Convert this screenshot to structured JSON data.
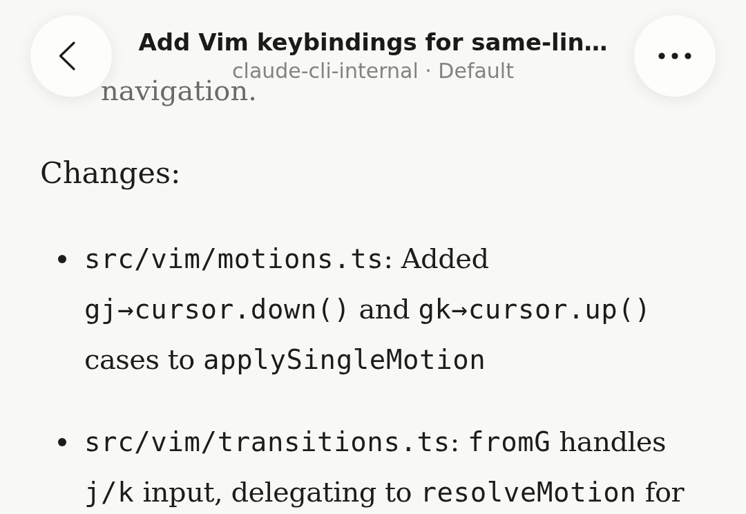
{
  "header": {
    "title": "Add Vim keybindings for same-lin…",
    "subtitle": "claude-cli-internal · Default"
  },
  "body": {
    "previous_text": "navigation.",
    "heading": "Changes:",
    "list": [
      {
        "segments": [
          {
            "kind": "code",
            "text": "src/vim/motions.ts"
          },
          {
            "kind": "text",
            "text": ": Added "
          },
          {
            "kind": "code",
            "text": "gj→cursor.down()"
          },
          {
            "kind": "text",
            "text": " and "
          },
          {
            "kind": "code",
            "text": "gk→cursor.up()"
          },
          {
            "kind": "text",
            "text": " cases to "
          },
          {
            "kind": "code",
            "text": "applySingleMotion"
          }
        ]
      },
      {
        "segments": [
          {
            "kind": "code",
            "text": "src/vim/transitions.ts"
          },
          {
            "kind": "text",
            "text": ": "
          },
          {
            "kind": "code",
            "text": "fromG"
          },
          {
            "kind": "text",
            "text": " handles "
          },
          {
            "kind": "code",
            "text": "j/k"
          },
          {
            "kind": "text",
            "text": " input, delegating to "
          },
          {
            "kind": "code",
            "text": "resolveMotion"
          },
          {
            "kind": "text",
            "text": " for"
          }
        ]
      }
    ]
  }
}
